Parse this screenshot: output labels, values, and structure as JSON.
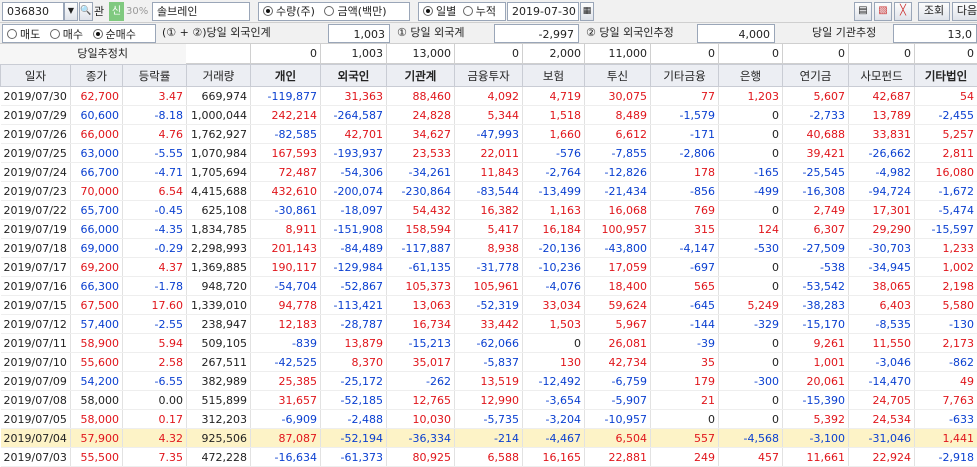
{
  "toolbar": {
    "code": "036830",
    "flags": [
      "관",
      "신",
      "30%"
    ],
    "name": "솔브레인",
    "unit_options": [
      "수량(주)",
      "금액(백만)"
    ],
    "period_options": [
      "일별",
      "누적"
    ],
    "date": "2019-07-30",
    "query_label": "조회",
    "next_label": "다음"
  },
  "filter": {
    "trade_options": [
      "매도",
      "매수",
      "순매수"
    ],
    "label_combined": "(① + ②)당일 외국인계",
    "val_combined": "1,003",
    "label_foreign": "① 당일 외국계",
    "val_foreign": "-2,997",
    "label_foreigner": "② 당일 외국인추정",
    "val_foreigner": "4,000",
    "label_inst": "당일 기관추정",
    "val_inst": "13,0"
  },
  "estimate": {
    "label": "당일추정치",
    "values": [
      "0",
      "1,003",
      "13,000",
      "0",
      "2,000",
      "11,000",
      "0",
      "0",
      "0",
      "0",
      "0"
    ]
  },
  "table": {
    "headers": [
      "일자",
      "종가",
      "등락률",
      "거래량",
      "개인",
      "외국인",
      "기관계",
      "금융투자",
      "보험",
      "투신",
      "기타금융",
      "은행",
      "연기금",
      "사모펀드",
      "기타법인"
    ],
    "rows": [
      [
        "2019/07/30",
        "62,700",
        "3.47",
        "669,974",
        "-119,877",
        "31,363",
        "88,460",
        "4,092",
        "4,719",
        "30,075",
        "77",
        "1,203",
        "5,607",
        "42,687",
        "54"
      ],
      [
        "2019/07/29",
        "60,600",
        "-8.18",
        "1,000,044",
        "242,214",
        "-264,587",
        "24,828",
        "5,344",
        "1,518",
        "8,489",
        "-1,579",
        "0",
        "-2,733",
        "13,789",
        "-2,455"
      ],
      [
        "2019/07/26",
        "66,000",
        "4.76",
        "1,762,927",
        "-82,585",
        "42,701",
        "34,627",
        "-47,993",
        "1,660",
        "6,612",
        "-171",
        "0",
        "40,688",
        "33,831",
        "5,257"
      ],
      [
        "2019/07/25",
        "63,000",
        "-5.55",
        "1,070,984",
        "167,593",
        "-193,937",
        "23,533",
        "22,011",
        "-576",
        "-7,855",
        "-2,806",
        "0",
        "39,421",
        "-26,662",
        "2,811"
      ],
      [
        "2019/07/24",
        "66,700",
        "-4.71",
        "1,705,694",
        "72,487",
        "-54,306",
        "-34,261",
        "11,843",
        "-2,764",
        "-12,826",
        "178",
        "-165",
        "-25,545",
        "-4,982",
        "16,080"
      ],
      [
        "2019/07/23",
        "70,000",
        "6.54",
        "4,415,688",
        "432,610",
        "-200,074",
        "-230,864",
        "-83,544",
        "-13,499",
        "-21,434",
        "-856",
        "-499",
        "-16,308",
        "-94,724",
        "-1,672"
      ],
      [
        "2019/07/22",
        "65,700",
        "-0.45",
        "625,108",
        "-30,861",
        "-18,097",
        "54,432",
        "16,382",
        "1,163",
        "16,068",
        "769",
        "0",
        "2,749",
        "17,301",
        "-5,474"
      ],
      [
        "2019/07/19",
        "66,000",
        "-4.35",
        "1,834,785",
        "8,911",
        "-151,908",
        "158,594",
        "5,417",
        "16,184",
        "100,957",
        "315",
        "124",
        "6,307",
        "29,290",
        "-15,597"
      ],
      [
        "2019/07/18",
        "69,000",
        "-0.29",
        "2,298,993",
        "201,143",
        "-84,489",
        "-117,887",
        "8,938",
        "-20,136",
        "-43,800",
        "-4,147",
        "-530",
        "-27,509",
        "-30,703",
        "1,233"
      ],
      [
        "2019/07/17",
        "69,200",
        "4.37",
        "1,369,885",
        "190,117",
        "-129,984",
        "-61,135",
        "-31,778",
        "-10,236",
        "17,059",
        "-697",
        "0",
        "-538",
        "-34,945",
        "1,002"
      ],
      [
        "2019/07/16",
        "66,300",
        "-1.78",
        "948,720",
        "-54,704",
        "-52,867",
        "105,373",
        "105,961",
        "-4,076",
        "18,400",
        "565",
        "0",
        "-53,542",
        "38,065",
        "2,198"
      ],
      [
        "2019/07/15",
        "67,500",
        "17.60",
        "1,339,010",
        "94,778",
        "-113,421",
        "13,063",
        "-52,319",
        "33,034",
        "59,624",
        "-645",
        "5,249",
        "-38,283",
        "6,403",
        "5,580"
      ],
      [
        "2019/07/12",
        "57,400",
        "-2.55",
        "238,947",
        "12,183",
        "-28,787",
        "16,734",
        "33,442",
        "1,503",
        "5,967",
        "-144",
        "-329",
        "-15,170",
        "-8,535",
        "-130"
      ],
      [
        "2019/07/11",
        "58,900",
        "5.94",
        "509,105",
        "-839",
        "13,879",
        "-15,213",
        "-62,066",
        "0",
        "26,081",
        "-39",
        "0",
        "9,261",
        "11,550",
        "2,173"
      ],
      [
        "2019/07/10",
        "55,600",
        "2.58",
        "267,511",
        "-42,525",
        "8,370",
        "35,017",
        "-5,837",
        "130",
        "42,734",
        "35",
        "0",
        "1,001",
        "-3,046",
        "-862"
      ],
      [
        "2019/07/09",
        "54,200",
        "-6.55",
        "382,989",
        "25,385",
        "-25,172",
        "-262",
        "13,519",
        "-12,492",
        "-6,759",
        "179",
        "-300",
        "20,061",
        "-14,470",
        "49"
      ],
      [
        "2019/07/08",
        "58,000",
        "0.00",
        "515,899",
        "31,657",
        "-52,185",
        "12,765",
        "12,990",
        "-3,654",
        "-5,907",
        "21",
        "0",
        "-15,390",
        "24,705",
        "7,763"
      ],
      [
        "2019/07/05",
        "58,000",
        "0.17",
        "312,203",
        "-6,909",
        "-2,488",
        "10,030",
        "-5,735",
        "-3,204",
        "-10,957",
        "0",
        "0",
        "5,392",
        "24,534",
        "-633"
      ],
      [
        "2019/07/04",
        "57,900",
        "4.32",
        "925,506",
        "87,087",
        "-52,194",
        "-36,334",
        "-214",
        "-4,467",
        "6,504",
        "557",
        "-4,568",
        "-3,100",
        "-31,046",
        "1,441"
      ],
      [
        "2019/07/03",
        "55,500",
        "7.35",
        "472,228",
        "-16,634",
        "-61,373",
        "80,925",
        "6,588",
        "16,165",
        "22,881",
        "249",
        "457",
        "11,661",
        "22,924",
        "-2,918"
      ]
    ],
    "highlight_row": 18
  },
  "colors": {
    "up": "#e0151b",
    "down": "#0a3fd0",
    "highlight": "#fdf3c7"
  }
}
